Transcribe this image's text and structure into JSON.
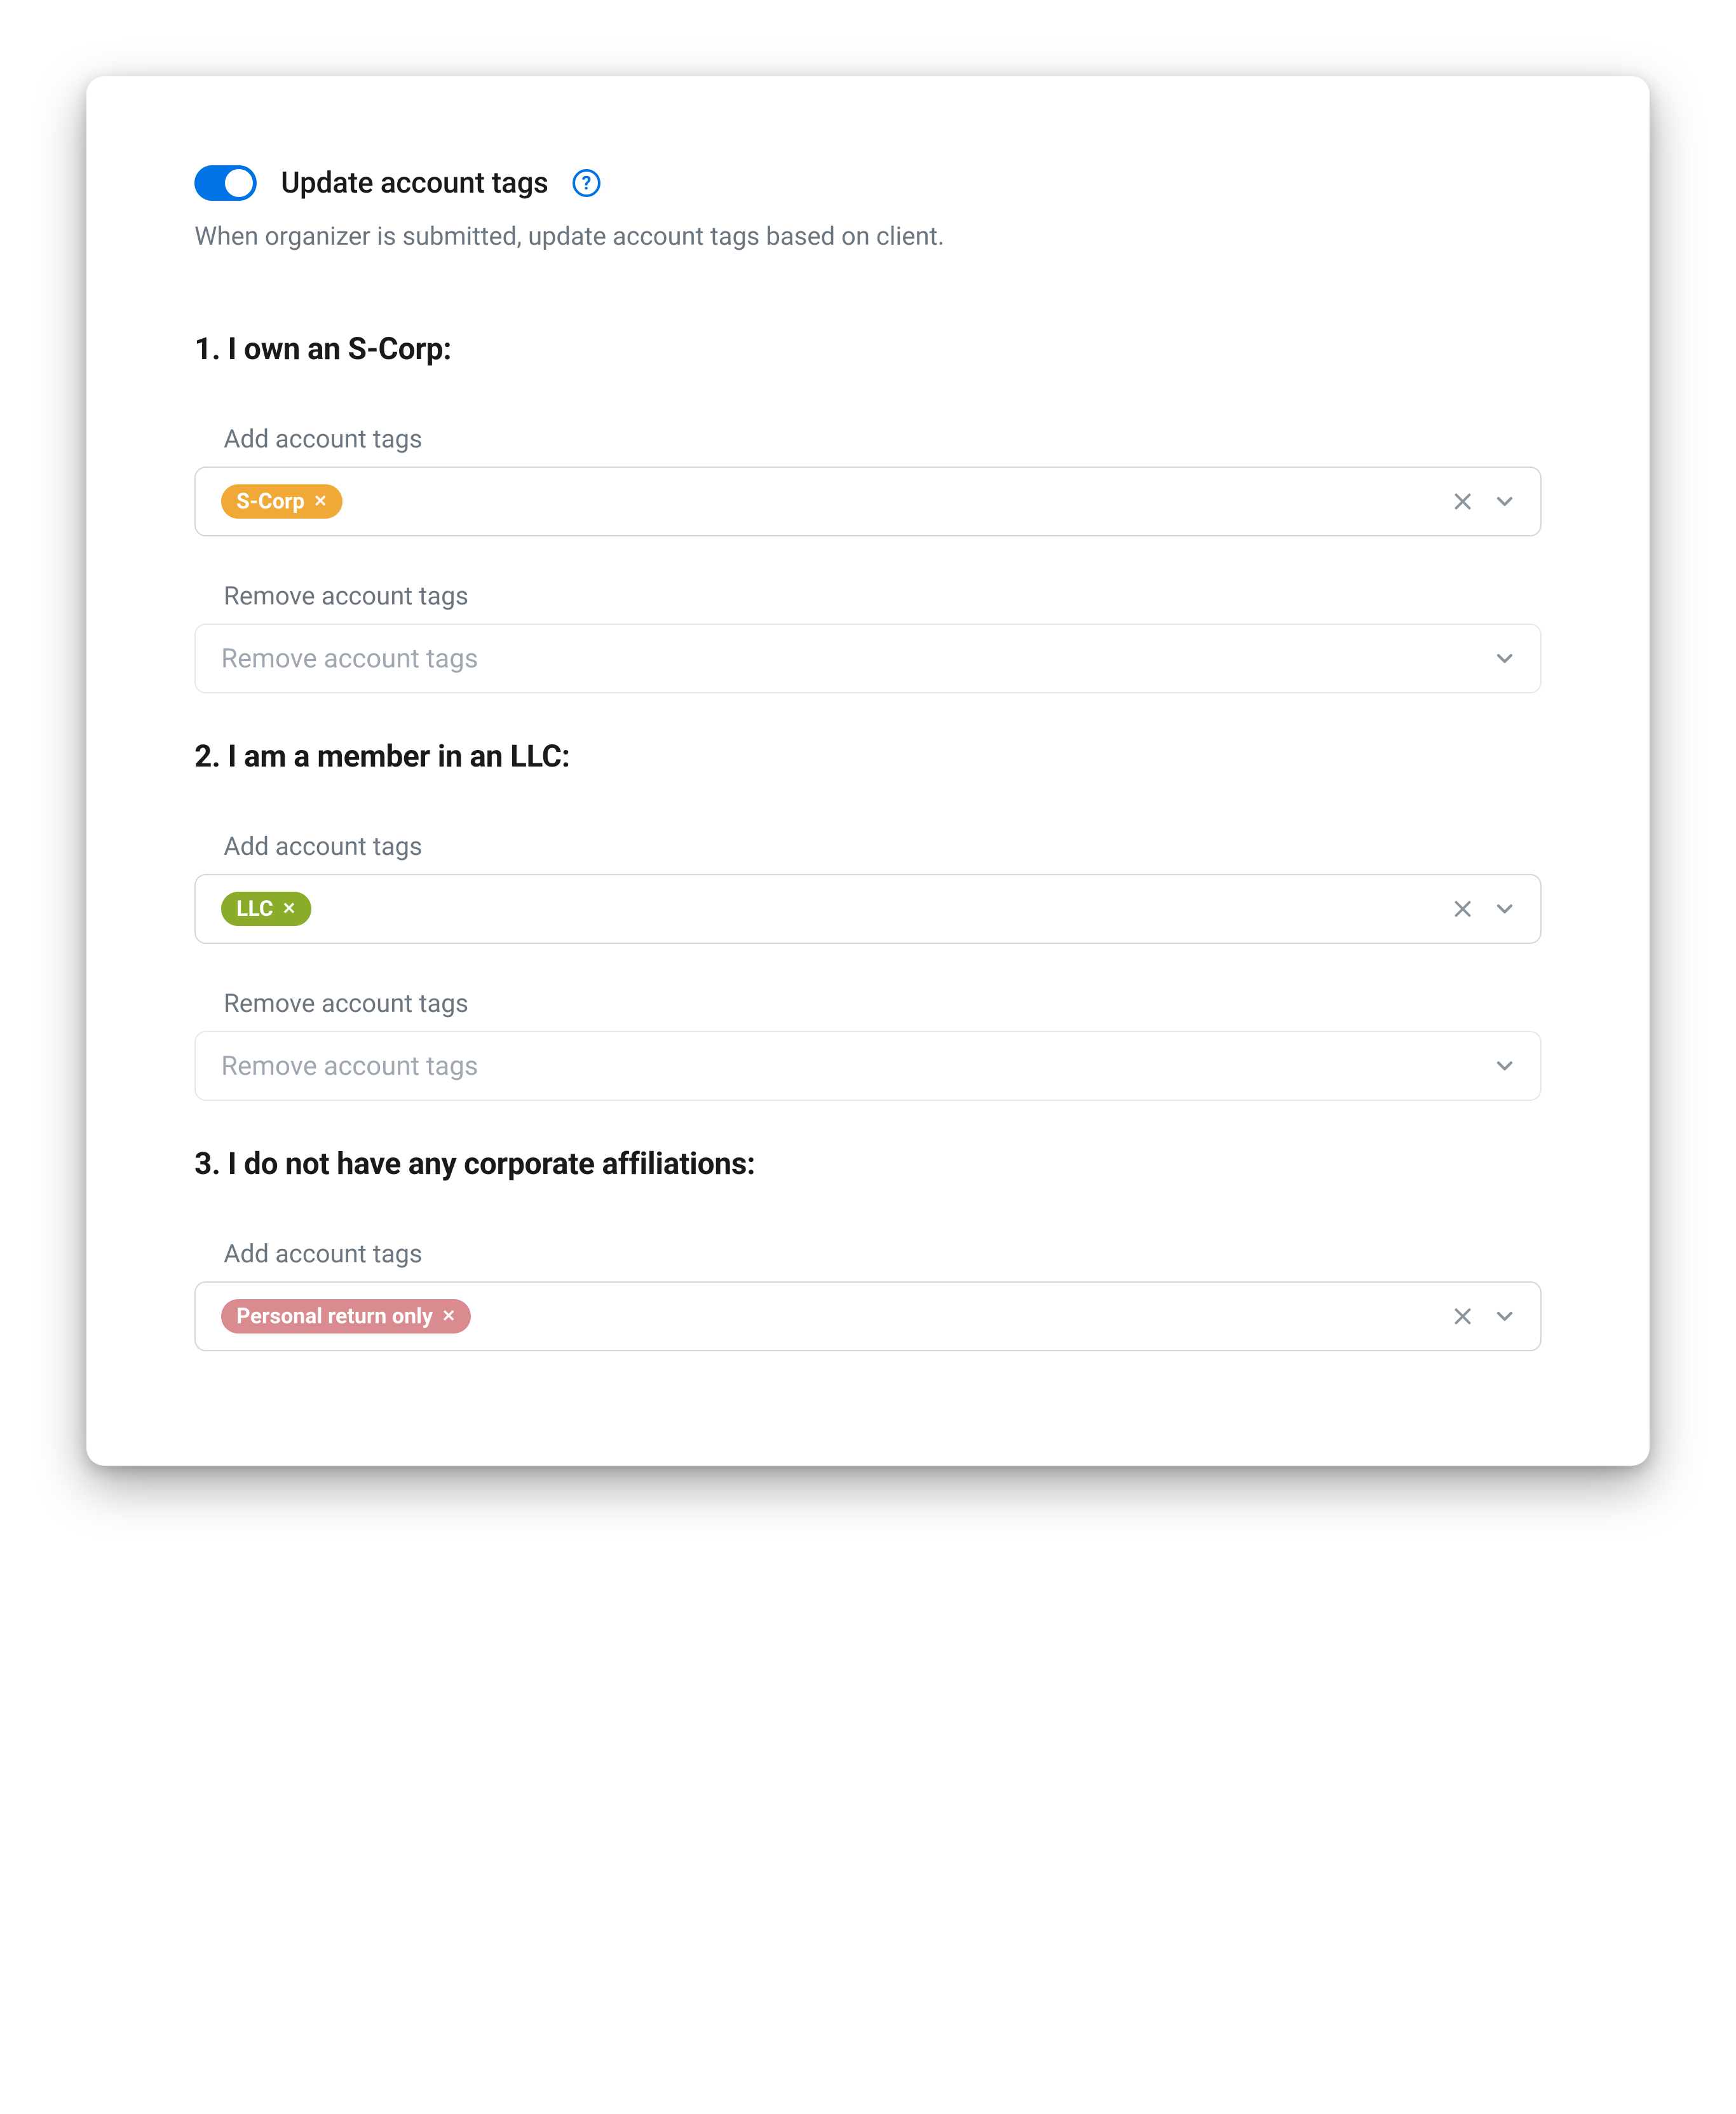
{
  "header": {
    "toggle_on": true,
    "title": "Update account tags",
    "subtitle": "When organizer is submitted, update account tags based on client."
  },
  "labels": {
    "add": "Add account tags",
    "remove": "Remove account tags",
    "remove_placeholder": "Remove account tags"
  },
  "sections": [
    {
      "title": "1. I own an S-Corp:",
      "add_tags": [
        {
          "label": "S-Corp",
          "color": "amber"
        }
      ],
      "has_remove": true
    },
    {
      "title": "2. I am a member in an LLC:",
      "add_tags": [
        {
          "label": "LLC",
          "color": "olive"
        }
      ],
      "has_remove": true
    },
    {
      "title": "3. I do not have any corporate affiliations:",
      "add_tags": [
        {
          "label": "Personal return only",
          "color": "rose"
        }
      ],
      "has_remove": false
    }
  ],
  "colors": {
    "blue": "#0073e6",
    "amber": "#f0a937",
    "olive": "#8aac2a",
    "rose": "#d98b8f"
  }
}
